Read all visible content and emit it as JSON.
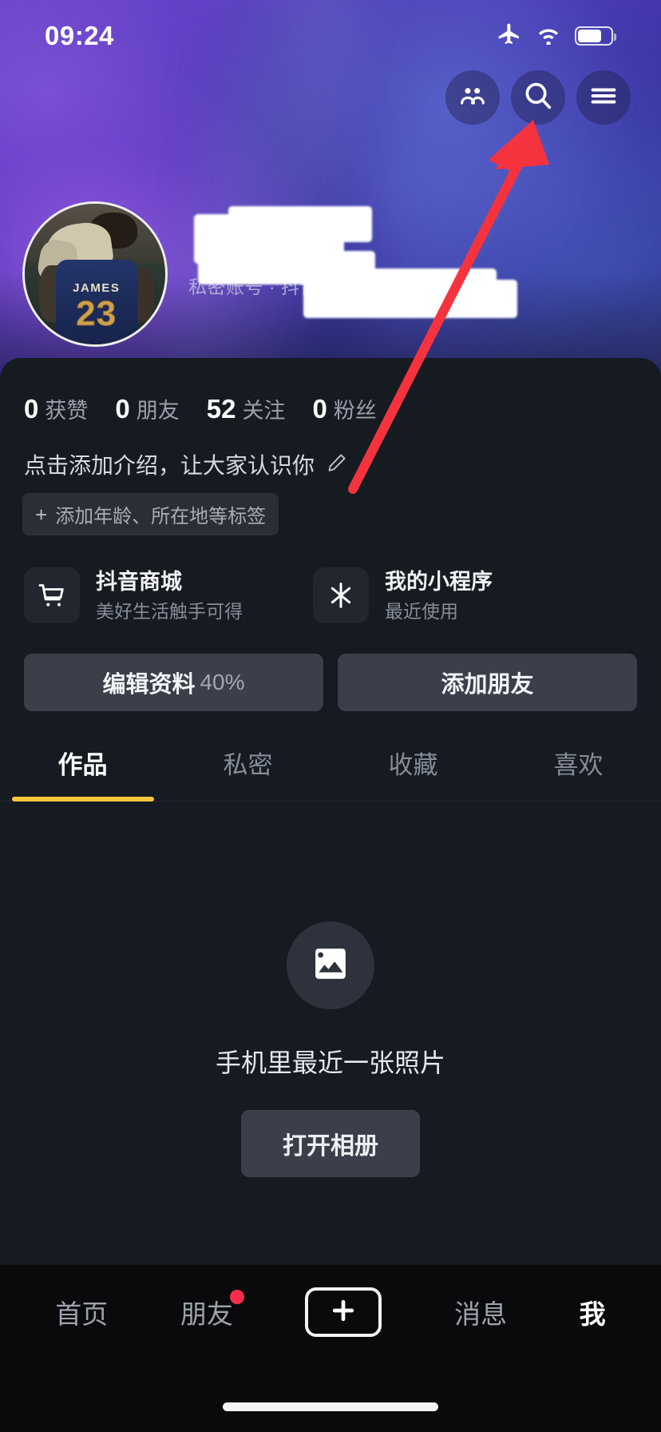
{
  "status_bar": {
    "time": "09:24",
    "airplane_icon": "airplane-mode-icon",
    "wifi_icon": "wifi-icon",
    "battery_icon": "battery-icon"
  },
  "header": {
    "friends_icon": "friends-icon",
    "search_icon": "search-icon",
    "menu_icon": "hamburger-menu-icon"
  },
  "profile": {
    "avatar_label": "JAMES",
    "avatar_number": "23",
    "subtitle": "私密账号 · 抖音号",
    "name_redacted": true
  },
  "stats": [
    {
      "value": "0",
      "label": "获赞"
    },
    {
      "value": "0",
      "label": "朋友"
    },
    {
      "value": "52",
      "label": "关注"
    },
    {
      "value": "0",
      "label": "粉丝"
    }
  ],
  "bio": {
    "placeholder": "点击添加介绍，让大家认识你",
    "edit_icon": "pencil-edit-icon",
    "tag_plus": "+",
    "tag_label": "添加年龄、所在地等标签"
  },
  "entries": [
    {
      "icon": "shopping-cart-icon",
      "title": "抖音商城",
      "subtitle": "美好生活触手可得"
    },
    {
      "icon": "mini-program-icon",
      "title": "我的小程序",
      "subtitle": "最近使用"
    }
  ],
  "actions": {
    "edit_profile_label": "编辑资料",
    "edit_profile_percent": "40%",
    "add_friend_label": "添加朋友"
  },
  "tabs": [
    {
      "label": "作品",
      "active": true
    },
    {
      "label": "私密",
      "active": false
    },
    {
      "label": "收藏",
      "active": false
    },
    {
      "label": "喜欢",
      "active": false
    }
  ],
  "empty_state": {
    "icon": "photo-image-icon",
    "text": "手机里最近一张照片",
    "button_label": "打开相册"
  },
  "bottom_nav": [
    {
      "label": "首页",
      "active": false,
      "badge": false
    },
    {
      "label": "朋友",
      "active": false,
      "badge": true
    },
    {
      "label": "消息",
      "active": false,
      "badge": false
    },
    {
      "label": "我",
      "active": true,
      "badge": false
    }
  ],
  "bottom_nav_create": {
    "icon": "plus-create-icon"
  },
  "annotation": {
    "arrow_color": "#f5333f",
    "points_to": "hamburger-menu-icon"
  },
  "colors": {
    "accent_yellow": "#f2c53d",
    "badge_red": "#fa2c4e",
    "sheet_bg": "#161a21",
    "nav_bg": "#0a0a0c"
  }
}
